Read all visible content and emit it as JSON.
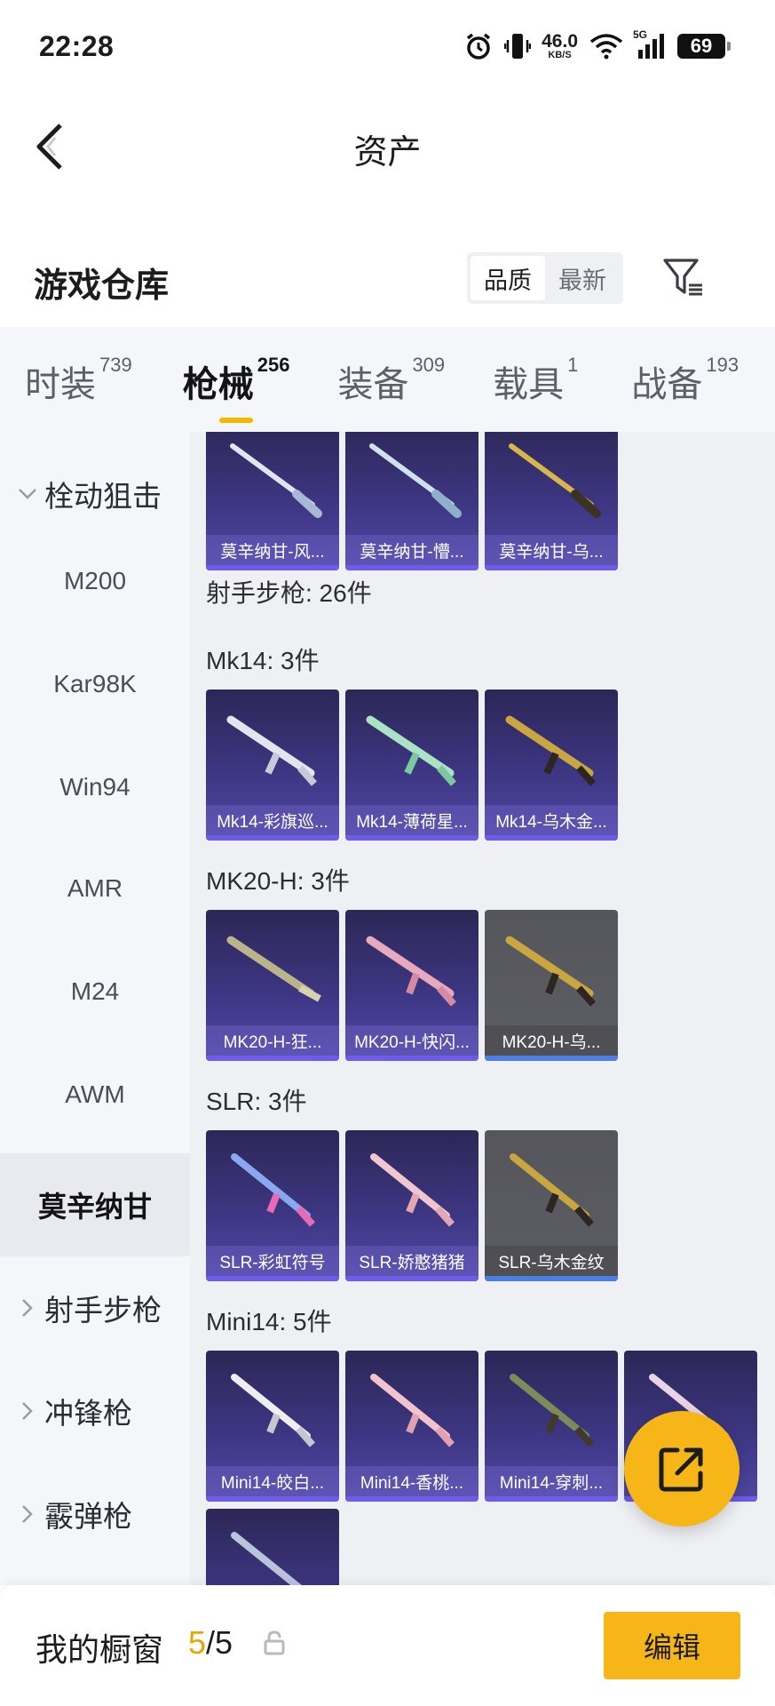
{
  "status_bar": {
    "time": "22:28",
    "net_speed": "46.0",
    "net_unit": "KB/S",
    "signal_type": "5G",
    "battery": "69"
  },
  "header": {
    "title": "资产"
  },
  "warehouse": {
    "title": "游戏仓库",
    "sort_options": [
      "品质",
      "最新"
    ],
    "sort_active": 0
  },
  "tabs": [
    {
      "label": "时装",
      "count": "739"
    },
    {
      "label": "枪械",
      "count": "256"
    },
    {
      "label": "装备",
      "count": "309"
    },
    {
      "label": "载具",
      "count": "1"
    },
    {
      "label": "战备",
      "count": "193"
    }
  ],
  "active_tab": 1,
  "sidebar": {
    "group_open": "栓动狙击",
    "items": [
      "M200",
      "Kar98K",
      "Win94",
      "AMR",
      "M24",
      "AWM"
    ],
    "selected": "莫辛纳甘",
    "groups_closed": [
      "射手步枪",
      "冲锋枪",
      "霰弹枪"
    ]
  },
  "content": {
    "top_cards": [
      "莫辛纳甘-风...",
      "莫辛纳甘-懵...",
      "莫辛纳甘-乌..."
    ],
    "dmr_section": "射手步枪: 26件",
    "mk14_section": "Mk14: 3件",
    "mk14_cards": [
      "Mk14-彩旗巡...",
      "Mk14-薄荷星...",
      "Mk14-乌木金..."
    ],
    "mk20_section": "MK20-H: 3件",
    "mk20_cards": [
      "MK20-H-狂...",
      "MK20-H-快闪...",
      "MK20-H-乌..."
    ],
    "slr_section": "SLR: 3件",
    "slr_cards": [
      "SLR-彩虹符号",
      "SLR-娇憨猪猪",
      "SLR-乌木金纹"
    ],
    "mini14_section": "Mini14: 5件",
    "mini14_cards": [
      "Mini14-皎白...",
      "Mini14-香桃...",
      "Mini14-穿刺..."
    ]
  },
  "bottom_bar": {
    "label": "我的橱窗",
    "current": "5",
    "total": "/5",
    "edit_label": "编辑"
  },
  "colors": {
    "accent": "#f7b618",
    "card_purple": "#3d3682",
    "card_gray": "#5d5e64"
  }
}
